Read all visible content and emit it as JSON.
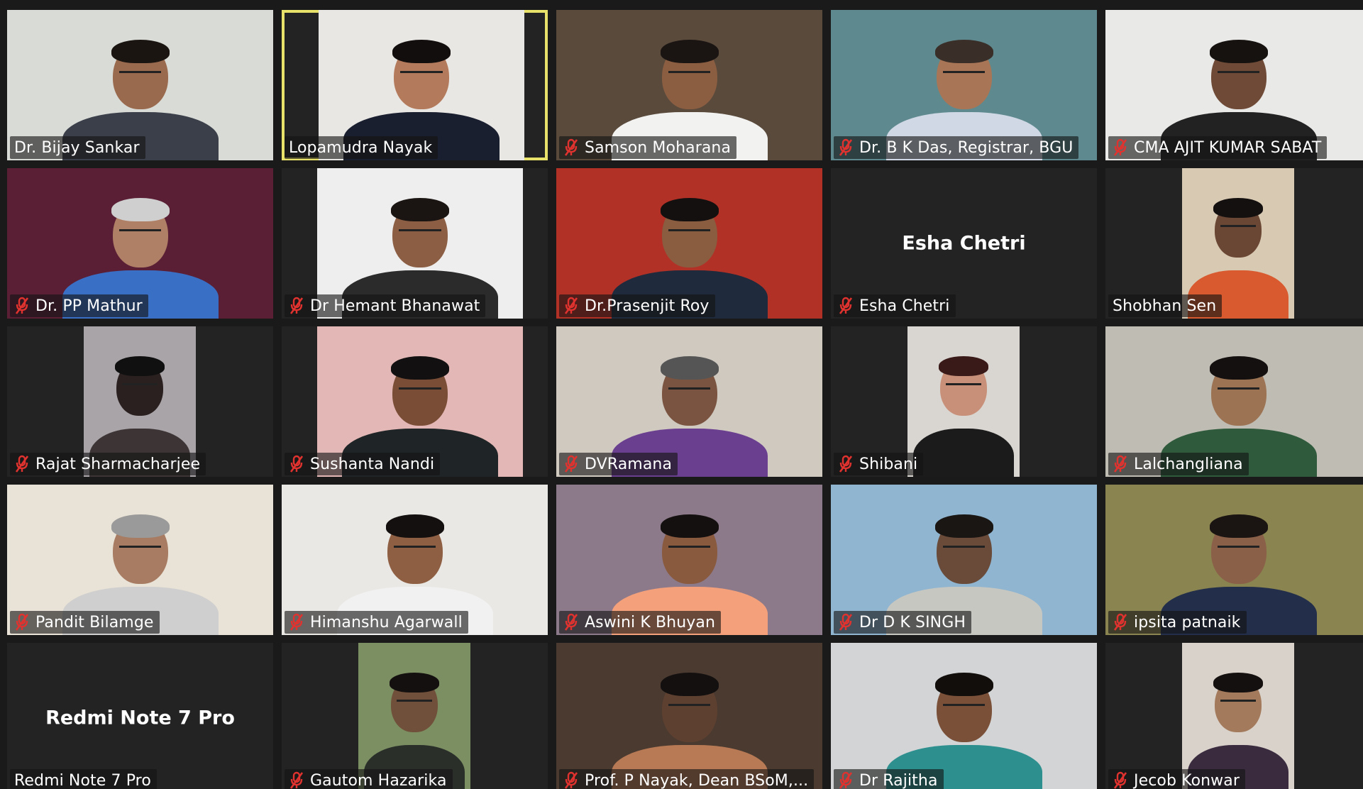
{
  "meeting": {
    "view": "gallery",
    "participants": [
      {
        "name": "Dr. Bijay Sankar",
        "muted": false,
        "active_speaker": false,
        "video": true,
        "bg": "#d9dbd6",
        "skin": "#9a6a4e",
        "shirt": "#3a3f4a",
        "hair": "#1b1512"
      },
      {
        "name": "Lopamudra Nayak",
        "muted": false,
        "active_speaker": true,
        "video": true,
        "bg": "#e8e7e4",
        "skin": "#b47a5c",
        "shirt": "#1a1f2f",
        "hair": "#120e0d"
      },
      {
        "name": "Samson Moharana",
        "muted": true,
        "active_speaker": false,
        "video": true,
        "bg": "#5a4a3c",
        "skin": "#8b5e42",
        "shirt": "#f2f2f0",
        "hair": "#1a1412"
      },
      {
        "name": "Dr. B K Das, Registrar, BGU",
        "muted": true,
        "active_speaker": false,
        "video": true,
        "bg": "#5e8a8f",
        "skin": "#a87656",
        "shirt": "#cfd8e4",
        "hair": "#3a2e28"
      },
      {
        "name": "CMA AJIT KUMAR SABAT",
        "muted": true,
        "active_speaker": false,
        "video": true,
        "bg": "#e9e9e8",
        "skin": "#6e4a37",
        "shirt": "#222222",
        "hair": "#151210"
      },
      {
        "name": "Dr. PP Mathur",
        "muted": true,
        "active_speaker": false,
        "video": true,
        "bg": "#5a1f35",
        "skin": "#b08066",
        "shirt": "#3a6fc6",
        "hair": "#cfcfcf"
      },
      {
        "name": "Dr Hemant Bhanawat",
        "muted": true,
        "active_speaker": false,
        "video": true,
        "bg": "#eeeeee",
        "skin": "#8c5e44",
        "shirt": "#2b2b2b",
        "hair": "#1a1412"
      },
      {
        "name": "Dr.Prasenjit Roy",
        "muted": true,
        "active_speaker": false,
        "video": true,
        "bg": "#b23127",
        "skin": "#8a5c40",
        "shirt": "#1f2a3d",
        "hair": "#141010"
      },
      {
        "name": "Esha Chetri",
        "muted": true,
        "active_speaker": false,
        "video": false,
        "display_label": "Esha Chetri"
      },
      {
        "name": "Shobhan Sen",
        "muted": false,
        "active_speaker": false,
        "video": true,
        "bg": "#d8c9b2",
        "skin": "#6a4634",
        "shirt": "#d85a2e",
        "hair": "#151010"
      },
      {
        "name": "Rajat Sharmacharjee",
        "muted": true,
        "active_speaker": false,
        "video": true,
        "bg": "#a8a4a8",
        "skin": "#2b2020",
        "shirt": "#3d3535",
        "hair": "#101010"
      },
      {
        "name": "Sushanta Nandi",
        "muted": true,
        "active_speaker": false,
        "video": true,
        "bg": "#e3b7b5",
        "skin": "#7a4e36",
        "shirt": "#1f2426",
        "hair": "#121010"
      },
      {
        "name": "DVRamana",
        "muted": true,
        "active_speaker": false,
        "video": true,
        "bg": "#cfc9c0",
        "skin": "#7a5440",
        "shirt": "#6b3f8f",
        "hair": "#555555"
      },
      {
        "name": "Shibani",
        "muted": true,
        "active_speaker": false,
        "video": true,
        "bg": "#d9d6d2",
        "skin": "#c89078",
        "shirt": "#1b1b1b",
        "hair": "#3a1a18"
      },
      {
        "name": "Lalchangliana",
        "muted": true,
        "active_speaker": false,
        "video": true,
        "bg": "#bfbcb4",
        "skin": "#9c7454",
        "shirt": "#2f5a3c",
        "hair": "#141010"
      },
      {
        "name": "Pandit Bilamge",
        "muted": true,
        "active_speaker": false,
        "video": true,
        "bg": "#e9e2d6",
        "skin": "#a77c62",
        "shirt": "#cfcfcf",
        "hair": "#9a9a9a"
      },
      {
        "name": "Himanshu Agarwall",
        "muted": true,
        "active_speaker": false,
        "video": true,
        "bg": "#e9e8e4",
        "skin": "#8e5f43",
        "shirt": "#f1f1f1",
        "hair": "#151010"
      },
      {
        "name": "Aswini K Bhuyan",
        "muted": true,
        "active_speaker": false,
        "video": true,
        "bg": "#8c7a8a",
        "skin": "#8a5a3f",
        "shirt": "#f4a07a",
        "hair": "#151010"
      },
      {
        "name": "Dr D K SINGH",
        "muted": true,
        "active_speaker": false,
        "video": true,
        "bg": "#8fb5d0",
        "skin": "#6a4a38",
        "shirt": "#c7c7c2",
        "hair": "#1a1614"
      },
      {
        "name": "ipsita patnaik",
        "muted": true,
        "active_speaker": false,
        "video": true,
        "bg": "#8a8450",
        "skin": "#8a6048",
        "shirt": "#232f4a",
        "hair": "#1a1412"
      },
      {
        "name": "Redmi Note 7 Pro",
        "muted": false,
        "active_speaker": false,
        "video": false,
        "display_label": "Redmi Note 7 Pro"
      },
      {
        "name": "Gautom Hazarika",
        "muted": true,
        "active_speaker": false,
        "video": true,
        "bg": "#7c8f62",
        "skin": "#70503a",
        "shirt": "#2a2f2a",
        "hair": "#141010"
      },
      {
        "name": "Prof. P Nayak, Dean BSoM,...",
        "muted": true,
        "active_speaker": false,
        "video": true,
        "bg": "#4a3a30",
        "skin": "#5e4030",
        "shirt": "#b87a55",
        "hair": "#141010"
      },
      {
        "name": "Dr Rajitha",
        "muted": true,
        "active_speaker": false,
        "video": true,
        "bg": "#d2d4d6",
        "skin": "#7a5038",
        "shirt": "#2e8f8f",
        "hair": "#120e0c"
      },
      {
        "name": "Jecob Konwar",
        "muted": true,
        "active_speaker": false,
        "video": true,
        "bg": "#d9d2ca",
        "skin": "#a37a5c",
        "shirt": "#3a2b3f",
        "hair": "#151010"
      }
    ]
  },
  "theme": {
    "background": "#1a1a1a",
    "active_speaker_border": "#e8e26a",
    "muted_icon_color": "#e0322e",
    "name_text_color": "#ffffff"
  }
}
